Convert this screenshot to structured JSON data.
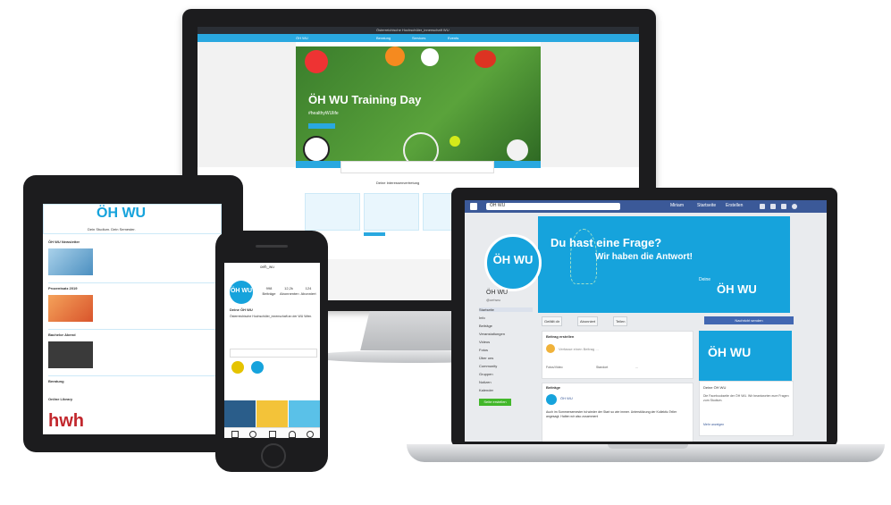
{
  "desktop": {
    "site_top": "Österreichische Hochschüler_innenschaft WU",
    "nav_items": [
      "ÖH WU",
      "Beratung",
      "Services",
      "Events"
    ],
    "hero_title": "ÖH WU Training Day",
    "hero_subtitle": "#healthyWUlife",
    "news_heading": "Deine Interessenvertretung"
  },
  "laptop": {
    "search_text": "ÖH WU",
    "user_items": [
      "Miriam",
      "Startseite",
      "Erstellen"
    ],
    "cover_line1": "Du hast eine Frage?",
    "cover_line2": "Wir haben die Antwort!",
    "cover_deine": "Deine",
    "logo_text": "ÖH WU",
    "page_name": "ÖH WU",
    "page_handle": "@oehwu",
    "sidebar_items": [
      "Startseite",
      "Info",
      "Beiträge",
      "Veranstaltungen",
      "Videos",
      "Fotos",
      "Über uns",
      "Community",
      "Gruppen",
      "Notizen",
      "Kalender"
    ],
    "sidebar_green": "Seite erstellen",
    "controls": [
      "Gefällt dir",
      "Abonniert",
      "Teilen"
    ],
    "message_button": "Nachricht senden",
    "post_box_title": "Beitrag erstellen",
    "post_placeholder": "Verfasse einen Beitrag ...",
    "post_actions": [
      "Fotos/Video",
      "Standort",
      "..."
    ],
    "posts_title": "Beiträge",
    "post_author": "ÖH WU",
    "post_text": "Auch im Sommersemester ist wieder der Start so wie immer. Unterstützung der Kollektiv-Teller angesagt. Halten wir also zusammen!",
    "right_card_logo": "ÖH WU",
    "right_card_title": "Deine ÖH WU",
    "right_card_text": "Die Facebookseite der ÖH WU. Wir beantworten eure Fragen zum Studium.",
    "right_card_link": "Mehr anzeigen"
  },
  "tablet": {
    "logo": "ÖH WU",
    "subtitle": "Dein Studium. Dein Semester.",
    "sections": [
      {
        "title": "ÖH WU Newsletter"
      },
      {
        "title": "Prozentsatz 2019"
      },
      {
        "title": "Bachelor Abend"
      },
      {
        "title": "Beratung"
      },
      {
        "title": "Online Library"
      }
    ],
    "footer_logo": "hwh"
  },
  "phone": {
    "username": "oeh_wu",
    "avatar_text": "ÖH WU",
    "stats": [
      {
        "value": "998",
        "label": "Beiträge"
      },
      {
        "value": "12,2k",
        "label": "Abonnenten"
      },
      {
        "value": "124",
        "label": "Abonniert"
      }
    ],
    "name": "Deine ÖH WU",
    "bio": "Österreichische Hochschüler_innenschaft an der WU Wien."
  }
}
